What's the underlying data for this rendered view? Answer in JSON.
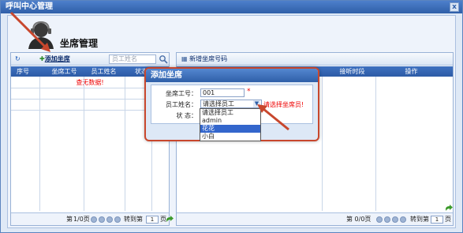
{
  "window": {
    "title": "呼叫中心管理",
    "close": "x"
  },
  "page": {
    "title": "坐席管理"
  },
  "left": {
    "add_label": "添加坐席",
    "search_placeholder": "员工姓名",
    "columns": [
      "序号",
      "坐席工号",
      "员工姓名",
      "状态"
    ],
    "no_data": "查无数据!",
    "pager": {
      "prefix": "第",
      "page": "1",
      "suffix": "/0页",
      "goto": "转到第",
      "goto_value": "1",
      "goto_unit": "页"
    }
  },
  "right": {
    "add_label": "新增坐席号码",
    "columns": [
      "接听时段",
      "操作"
    ],
    "pager": {
      "text": "第 0/0页",
      "goto": "转到第",
      "goto_value": "1",
      "goto_unit": "页"
    }
  },
  "dialog": {
    "title": "添加坐席",
    "fields": {
      "agent_no_label": "坐席工号：",
      "agent_no_value": "001",
      "required": "*",
      "employee_label": "员工姓名：",
      "employee_value": "请选择员工",
      "employee_error": "请选择坐席员!",
      "status_label": "状    态："
    },
    "options": [
      "请选择员工",
      "admin",
      "花花",
      "小白"
    ],
    "selected_option": "花花"
  },
  "colors": {
    "header_blue": "#2f5fa8",
    "arrow": "#c8472d",
    "error": "#ee0000"
  }
}
